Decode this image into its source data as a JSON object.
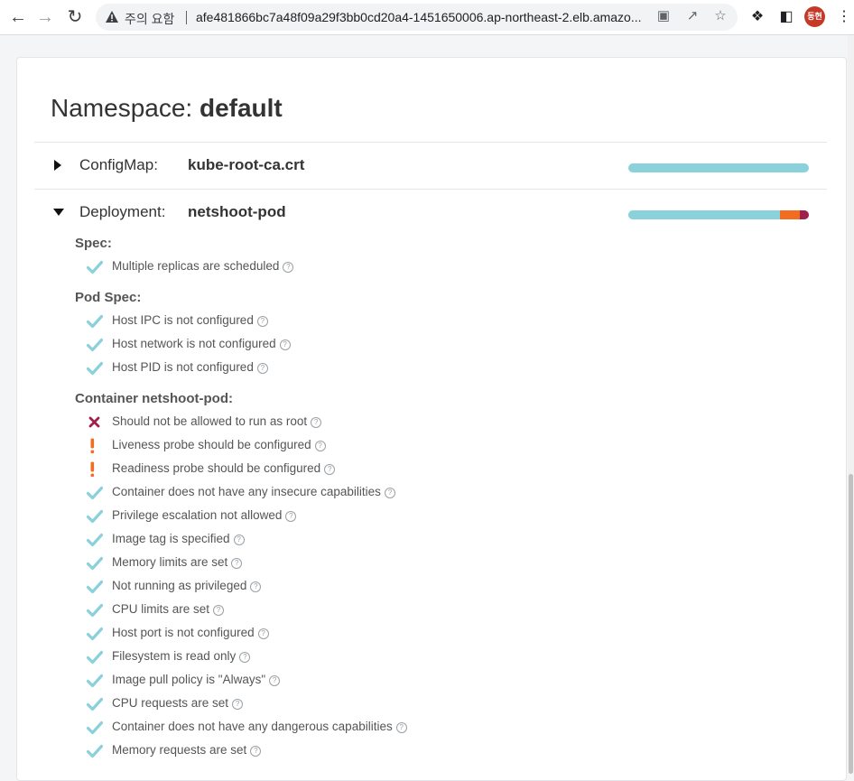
{
  "browser": {
    "security_label": "주의 요함",
    "url": "afe481866bc7a48f09a29f3bb0cd20a4-1451650006.ap-northeast-2.elb.amazo...",
    "avatar_label": "동현"
  },
  "page": {
    "namespace_label": "Namespace:",
    "namespace_value": "default"
  },
  "resources": [
    {
      "kind": "ConfigMap:",
      "name": "kube-root-ca.crt",
      "expanded": false,
      "score": {
        "pass": 1.0,
        "warning": 0.0,
        "danger": 0.0
      }
    },
    {
      "kind": "Deployment:",
      "name": "netshoot-pod",
      "expanded": true,
      "score": {
        "pass": 0.84,
        "warning": 0.11,
        "danger": 0.05
      }
    }
  ],
  "sections": [
    {
      "title": "Spec:",
      "checks": [
        {
          "status": "pass",
          "text": "Multiple replicas are scheduled"
        }
      ]
    },
    {
      "title": "Pod Spec:",
      "checks": [
        {
          "status": "pass",
          "text": "Host IPC is not configured"
        },
        {
          "status": "pass",
          "text": "Host network is not configured"
        },
        {
          "status": "pass",
          "text": "Host PID is not configured"
        }
      ]
    },
    {
      "title": "Container netshoot-pod:",
      "checks": [
        {
          "status": "danger",
          "text": "Should not be allowed to run as root"
        },
        {
          "status": "warning",
          "text": "Liveness probe should be configured"
        },
        {
          "status": "warning",
          "text": "Readiness probe should be configured"
        },
        {
          "status": "pass",
          "text": "Container does not have any insecure capabilities"
        },
        {
          "status": "pass",
          "text": "Privilege escalation not allowed"
        },
        {
          "status": "pass",
          "text": "Image tag is specified"
        },
        {
          "status": "pass",
          "text": "Memory limits are set"
        },
        {
          "status": "pass",
          "text": "Not running as privileged"
        },
        {
          "status": "pass",
          "text": "CPU limits are set"
        },
        {
          "status": "pass",
          "text": "Host port is not configured"
        },
        {
          "status": "pass",
          "text": "Filesystem is read only"
        },
        {
          "status": "pass",
          "text": "Image pull policy is \"Always\""
        },
        {
          "status": "pass",
          "text": "CPU requests are set"
        },
        {
          "status": "pass",
          "text": "Container does not have any dangerous capabilities"
        },
        {
          "status": "pass",
          "text": "Memory requests are set"
        }
      ]
    }
  ],
  "colors": {
    "pass": "#8ad1dc",
    "warning": "#f26c21",
    "danger": "#a11f4c"
  },
  "icons": {
    "pass": "check-icon",
    "warning": "exclamation-icon",
    "danger": "cross-icon",
    "help": "help-circle-icon"
  }
}
